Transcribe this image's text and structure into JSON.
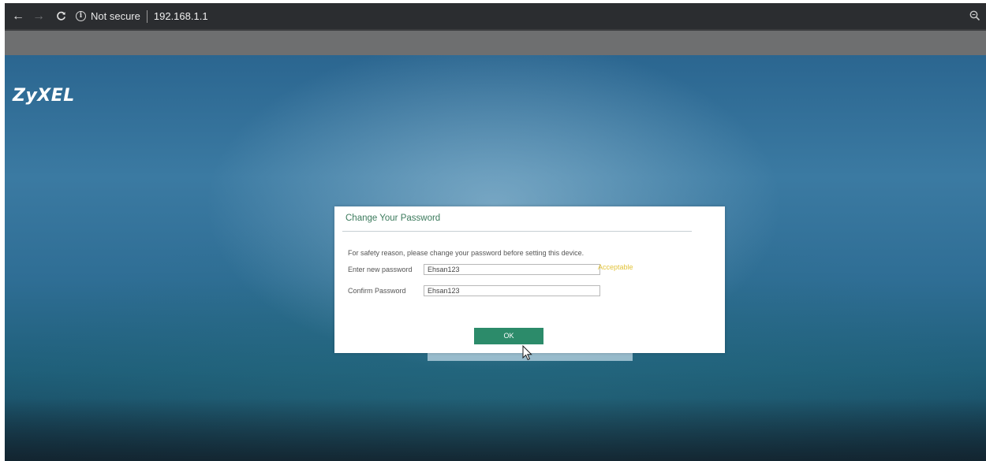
{
  "browser": {
    "security_text": "Not secure",
    "url": "192.168.1.1",
    "icons": {
      "back": "back-arrow-icon",
      "forward": "forward-arrow-icon",
      "reload": "reload-icon",
      "info": "info-icon",
      "zoom": "zoom-icon"
    }
  },
  "page": {
    "logo": "ZyXEL",
    "dialog": {
      "title": "Change Your Password",
      "intro": "For safety reason, please change your password before setting this device.",
      "new_password_label": "Enter new password",
      "new_password_value": "Ehsan123",
      "strength_text": "Acceptable",
      "confirm_password_label": "Confirm Password",
      "confirm_password_value": "Ehsan123",
      "ok_label": "OK"
    }
  },
  "colors": {
    "accent_green": "#2c8b6a",
    "title_green": "#3b7a5c",
    "strength_yellow": "#e2c33a"
  }
}
